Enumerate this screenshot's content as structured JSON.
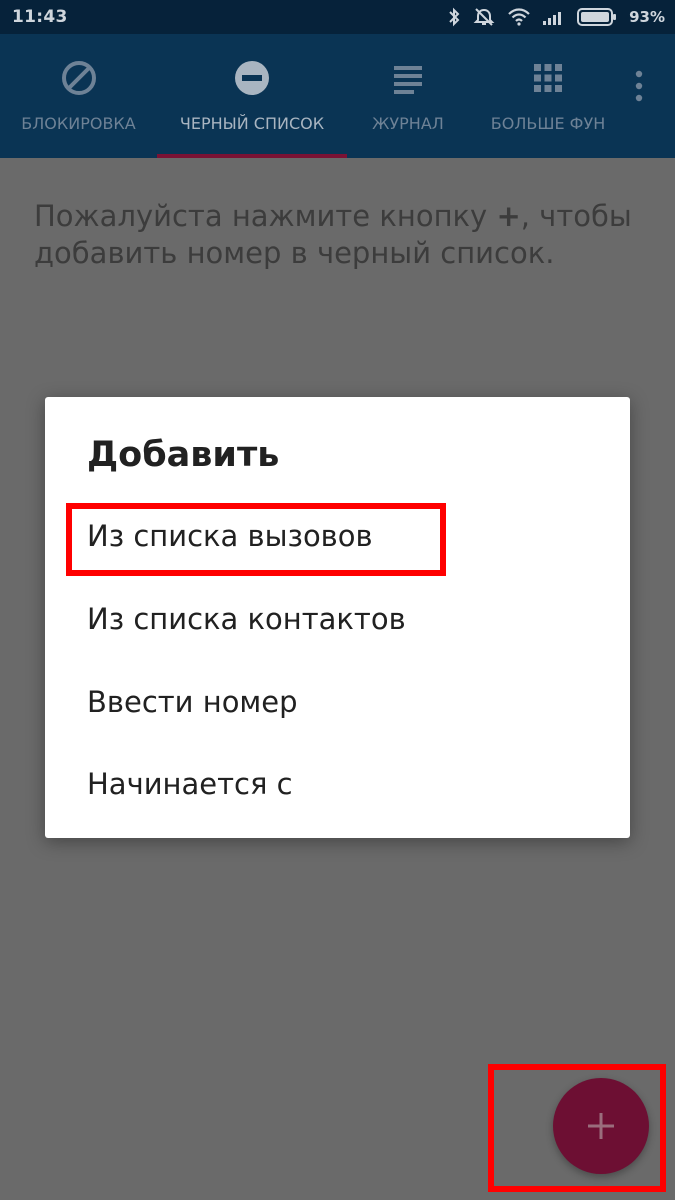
{
  "status_bar": {
    "time": "11:43",
    "battery_percent": "93%",
    "icons": [
      "bluetooth-icon",
      "alarm-off-icon",
      "wifi-icon",
      "signal-icon",
      "battery-icon"
    ]
  },
  "tabs": [
    {
      "label": "БЛОКИРОВКА",
      "icon": "block-icon",
      "active": false
    },
    {
      "label": "ЧЕРНЫЙ СПИСОК",
      "icon": "minus-circle-icon",
      "active": true
    },
    {
      "label": "ЖУРНАЛ",
      "icon": "list-icon",
      "active": false
    },
    {
      "label": "БОЛЬШЕ ФУН",
      "icon": "grid-icon",
      "active": false
    }
  ],
  "content": {
    "hint_before": "Пожалуйста нажмите кнопку ",
    "hint_plus": "+",
    "hint_after": ", чтобы добавить номер в черный список."
  },
  "dialog": {
    "title": "Добавить",
    "items": [
      {
        "label": "Из списка вызовов"
      },
      {
        "label": "Из списка контактов"
      },
      {
        "label": "Ввести номер"
      },
      {
        "label": "Начинается с"
      }
    ]
  },
  "fab": {
    "icon": "plus-icon"
  },
  "colors": {
    "app_bar": "#0a3454",
    "status_bar": "#06223a",
    "accent": "#7a1234",
    "fab": "#6d0f33",
    "highlight": "#ff0000"
  }
}
